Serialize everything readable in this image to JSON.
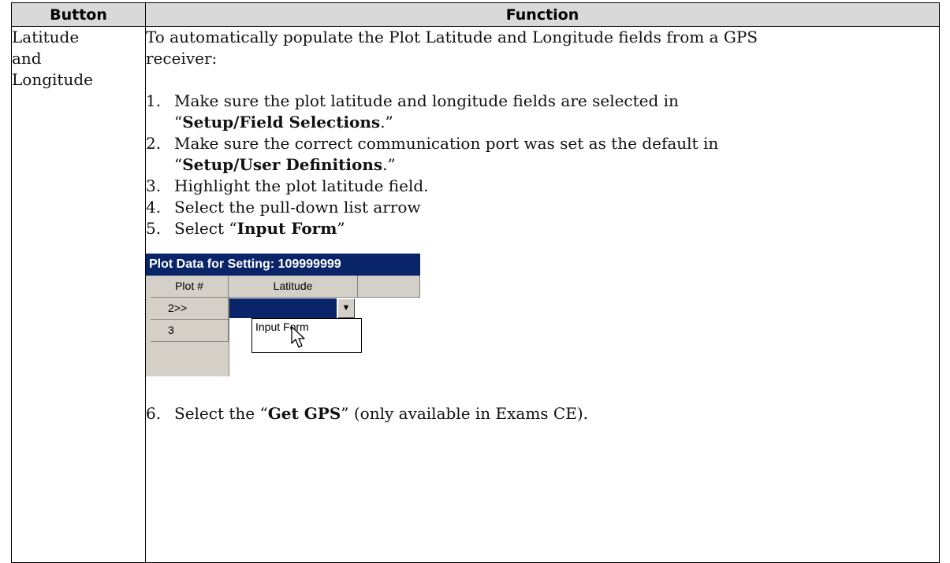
{
  "table": {
    "headers": {
      "button": "Button",
      "function": "Function"
    },
    "row": {
      "button_lines": [
        "Latitude",
        "and",
        "Longitude"
      ],
      "intro_lines": [
        "To automatically populate the Plot Latitude and Longitude fields from a GPS",
        "receiver:"
      ],
      "steps": [
        {
          "num": "1.",
          "line1": "Make sure the plot latitude and longitude fields are selected in",
          "pre": "“",
          "bold": "Setup/Field Selections",
          "post": ".”"
        },
        {
          "num": "2.",
          "line1": "Make sure the correct communication port was set as the default in",
          "pre": "“",
          "bold": "Setup/User Definitions",
          "post": ".”"
        },
        {
          "num": "3.",
          "text": "Highlight the plot latitude field."
        },
        {
          "num": "4.",
          "text": "Select the pull-down list arrow"
        },
        {
          "num": "5.",
          "pre": "Select “",
          "bold": "Input Form",
          "post": "”"
        }
      ],
      "step6": {
        "num": "6.",
        "pre": "Select the “",
        "bold": "Get GPS",
        "post": "” (only available in Exams CE)."
      }
    }
  },
  "screenshot": {
    "window_title": "Plot Data for Setting: 109999999",
    "grid": {
      "col_headers": [
        "Plot #",
        "Latitude"
      ],
      "rows": [
        "2>>",
        "3"
      ]
    },
    "dropdown_arrow": "▼",
    "popup_option": "Input Form",
    "colors": {
      "title_bar": "#0a246a",
      "selection": "#0a246a",
      "grid_face": "#d4d0c8"
    }
  }
}
